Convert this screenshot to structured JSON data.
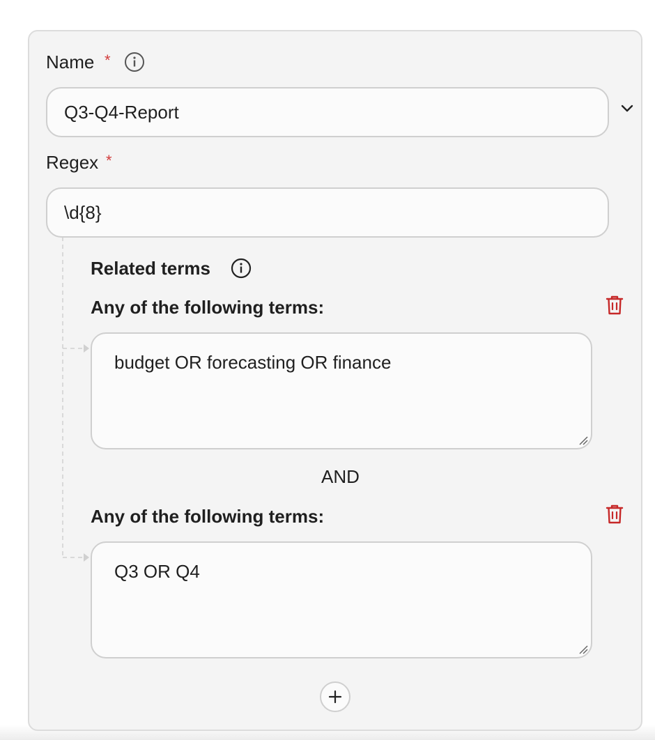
{
  "name_field": {
    "label": "Name",
    "required_mark": "*",
    "value": "Q3-Q4-Report"
  },
  "regex_field": {
    "label": "Regex",
    "required_mark": "*",
    "value": "\\d{8}"
  },
  "related_terms": {
    "title": "Related terms",
    "groups": [
      {
        "label": "Any of the following terms:",
        "value": "budget OR forecasting OR finance"
      },
      {
        "label": "Any of the following terms:",
        "value": "Q3 OR Q4"
      }
    ],
    "operator": "AND"
  },
  "icons": {
    "info": "info-icon",
    "chevron": "chevron-down-icon",
    "delete": "trash-icon",
    "add": "plus-icon"
  },
  "colors": {
    "required": "#d23c3c",
    "delete": "#c62828",
    "panel_bg": "#f4f4f4",
    "border": "#cfcfcf"
  }
}
